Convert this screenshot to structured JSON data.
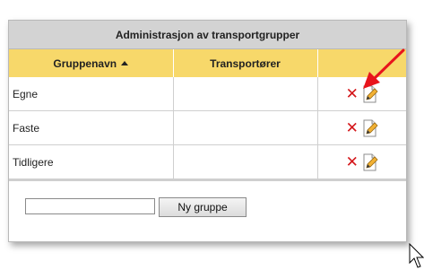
{
  "panel": {
    "title": "Administrasjon av transportgrupper"
  },
  "table": {
    "columns": [
      "Gruppenavn",
      "Transportører",
      ""
    ],
    "rows": [
      {
        "name": "Egne",
        "carriers": ""
      },
      {
        "name": "Faste",
        "carriers": ""
      },
      {
        "name": "Tidligere",
        "carriers": ""
      }
    ]
  },
  "actions": {
    "delete_icon": "red-x-delete-icon",
    "edit_icon": "document-pencil-edit-icon"
  },
  "add_group": {
    "input_value": "",
    "button_label": "Ny gruppe"
  },
  "colors": {
    "header_bg": "#f7d86a",
    "title_bg": "#d3d3d3",
    "delete": "#d4171b",
    "annotation_arrow": "#e8141c"
  }
}
